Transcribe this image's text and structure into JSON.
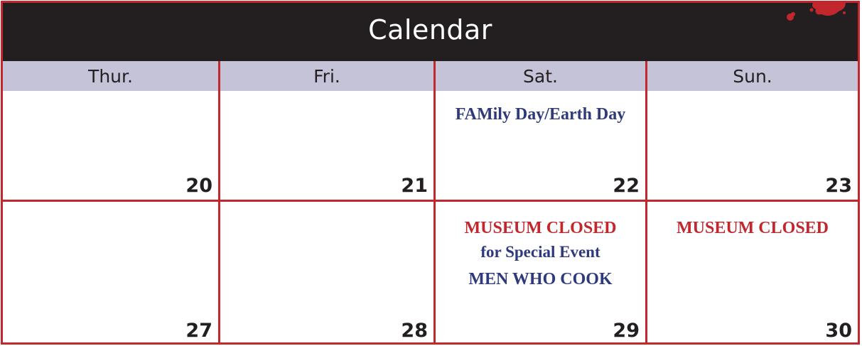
{
  "calendar": {
    "title": "Calendar",
    "days": [
      "Thur.",
      "Fri.",
      "Sat.",
      "Sun."
    ],
    "weeks": [
      {
        "dates": [
          "20",
          "21",
          "22",
          "23"
        ],
        "events": {
          "sat": {
            "line1": "FAMily Day/Earth Day"
          }
        }
      },
      {
        "dates": [
          "27",
          "28",
          "29",
          "30"
        ],
        "events": {
          "sat": {
            "line1": "MUSEUM CLOSED",
            "line2": "for Special Event",
            "line3": "MEN WHO COOK"
          },
          "sun": {
            "line1": "MUSEUM CLOSED"
          }
        }
      }
    ]
  },
  "colors": {
    "title_bar": "#231f20",
    "header_row": "#c5c3d8",
    "grid_red": "#c1272d",
    "event_navy": "#2e3a7c",
    "event_red": "#c1272d"
  },
  "icons": [
    "paint-splatter-icon"
  ]
}
